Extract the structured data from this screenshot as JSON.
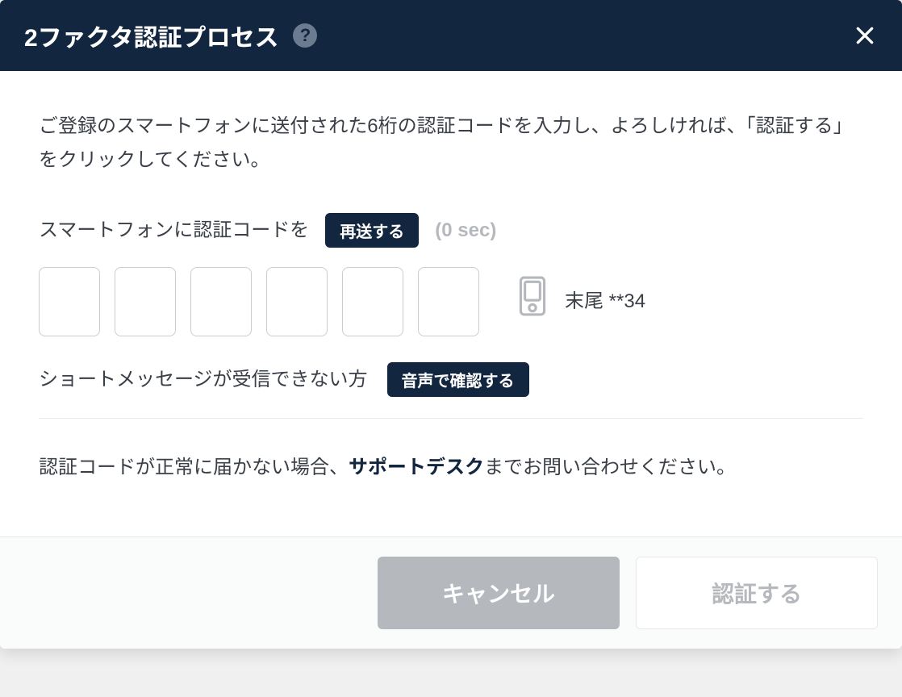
{
  "header": {
    "title": "2ファクタ認証プロセス",
    "help_label": "?"
  },
  "instruction": "ご登録のスマートフォンに送付された6桁の認証コードを入力し、よろしければ、「認証する」をクリックしてください。",
  "resend": {
    "label": "スマートフォンに認証コードを",
    "button": "再送する",
    "countdown": "(0 sec)"
  },
  "code": {
    "digits": [
      "",
      "",
      "",
      "",
      "",
      ""
    ],
    "masked_phone": "末尾 **34"
  },
  "voice": {
    "label": "ショートメッセージが受信できない方",
    "button": "音声で確認する"
  },
  "support": {
    "prefix": "認証コードが正常に届かない場合、",
    "link_text": "サポートデスク",
    "suffix": "までお問い合わせください。"
  },
  "footer": {
    "cancel": "キャンセル",
    "confirm": "認証する"
  }
}
